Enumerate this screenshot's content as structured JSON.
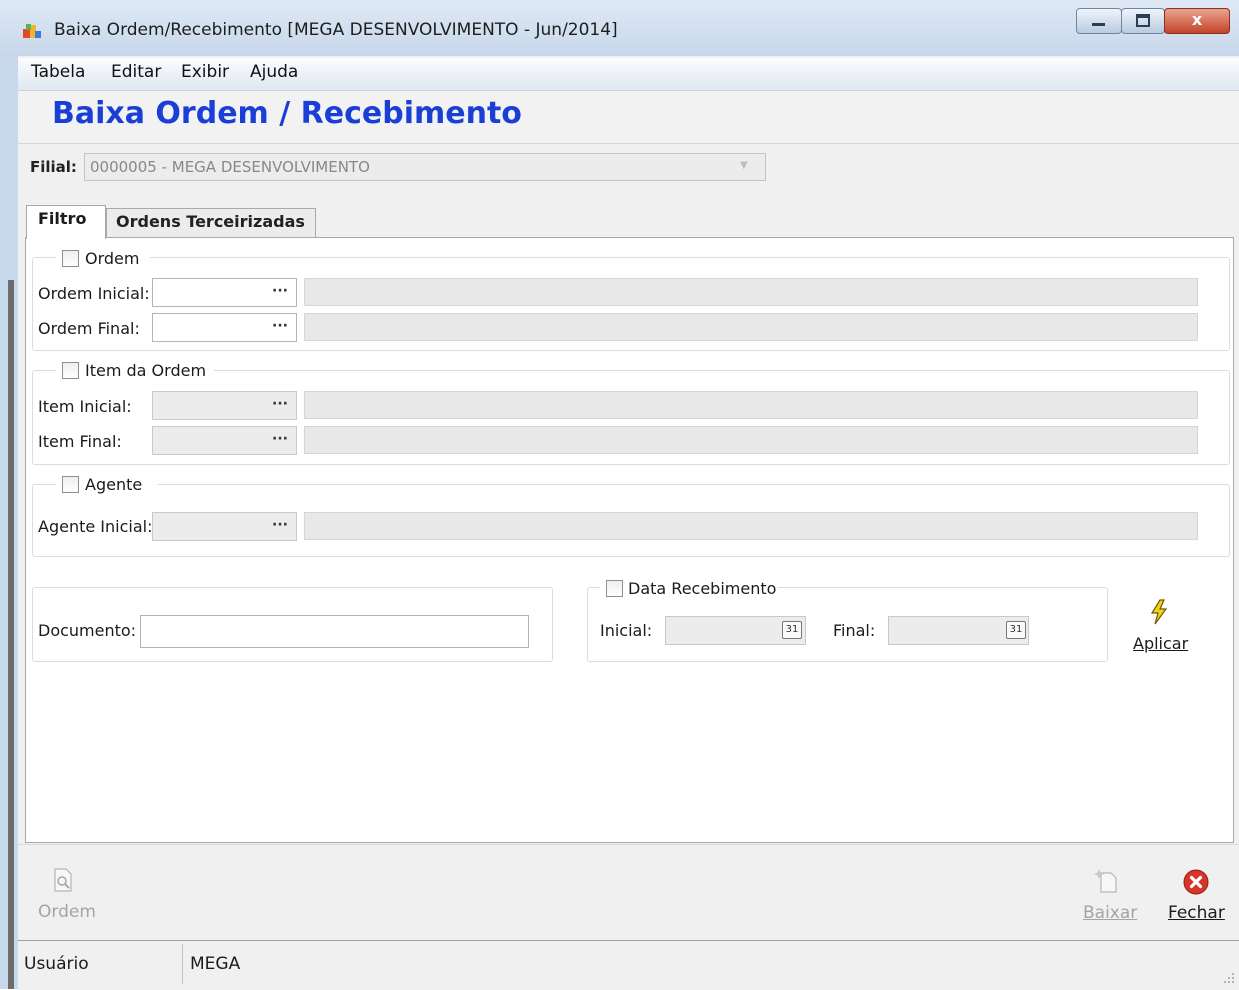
{
  "window": {
    "title": "Baixa Ordem/Recebimento [MEGA DESENVOLVIMENTO - Jun/2014]",
    "close_glyph": "x"
  },
  "menu": [
    "Tabela",
    "Editar",
    "Exibir",
    "Ajuda"
  ],
  "header": {
    "title": "Baixa Ordem / Recebimento"
  },
  "filial": {
    "label": "Filial:",
    "value": "0000005 - MEGA DESENVOLVIMENTO"
  },
  "tabs": [
    {
      "label": "Filtro",
      "active": true
    },
    {
      "label": "Ordens Terceirizadas",
      "active": false
    }
  ],
  "groups": {
    "ordem": {
      "label": "Ordem",
      "checked": false,
      "initial_label": "Ordem Inicial:",
      "final_label": "Ordem Final:"
    },
    "item": {
      "label": "Item da Ordem",
      "checked": false,
      "initial_label": "Item Inicial:",
      "final_label": "Item Final:"
    },
    "agente": {
      "label": "Agente",
      "checked": false,
      "initial_label": "Agente Inicial:"
    }
  },
  "lookup_glyph": "···",
  "documento": {
    "label": "Documento:",
    "value": ""
  },
  "data_recebimento": {
    "label": "Data Recebimento",
    "checked": false,
    "initial_label": "Inicial:",
    "final_label": "Final:",
    "cal_glyph": "31"
  },
  "actions": {
    "aplicar": "Aplicar"
  },
  "toolbar": {
    "ordem": "Ordem",
    "baixar": "Baixar",
    "fechar": "Fechar"
  },
  "status": {
    "user_label": "Usuário",
    "user_value": "MEGA"
  },
  "colors": {
    "title_blue": "#1a3fd6",
    "close_red": "#c4442a",
    "aplicar_icon": "#f2d21a"
  }
}
